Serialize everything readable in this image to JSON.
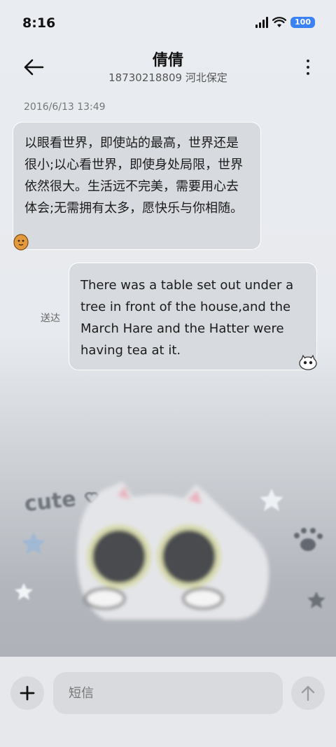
{
  "status_bar": {
    "time": "8:16",
    "battery": "100"
  },
  "header": {
    "contact_name": "倩倩",
    "contact_subtitle": "18730218809 河北保定"
  },
  "conversation": {
    "timestamp": "2016/6/13 13:49",
    "incoming_message": "以眼看世界，即使站的最高，世界还是很小;以心看世界，即使身处局限，世界依然很大。生活远不完美，需要用心去体会;无需拥有太多，愿快乐与你相随。",
    "outgoing_message": "There was a table set out under a tree in front of the house,and the March Hare and the Hatter were having tea at it.",
    "delivered_label": "送达"
  },
  "wallpaper": {
    "cute_text": "cute"
  },
  "composer": {
    "placeholder": "短信"
  },
  "icons": {
    "back": "back-arrow-icon",
    "more": "more-vertical-icon",
    "add": "plus-icon",
    "send": "send-arrow-icon"
  }
}
